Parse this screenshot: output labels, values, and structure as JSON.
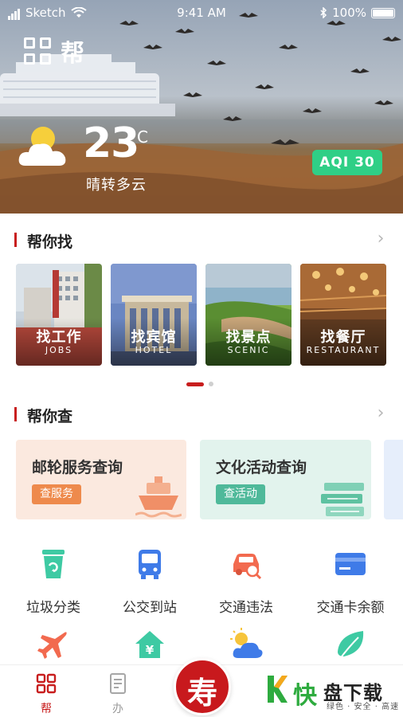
{
  "status_bar": {
    "carrier": "Sketch",
    "time": "9:41 AM",
    "battery": "100%"
  },
  "header": {
    "title": "帮"
  },
  "weather": {
    "temperature": "23",
    "unit": "°C",
    "condition": "晴转多云",
    "aqi_label": "AQI 30",
    "icon": "sun-cloud-icon"
  },
  "section_find": {
    "title": "帮你找",
    "cards": [
      {
        "label": "找工作",
        "sublabel": "JOBS"
      },
      {
        "label": "找宾馆",
        "sublabel": "HOTEL"
      },
      {
        "label": "找景点",
        "sublabel": "SCENIC"
      },
      {
        "label": "找餐厅",
        "sublabel": "RESTAURANT"
      }
    ]
  },
  "section_check": {
    "title": "帮你查",
    "cards": [
      {
        "title": "邮轮服务查询",
        "button": "查服务"
      },
      {
        "title": "文化活动查询",
        "button": "查活动"
      }
    ]
  },
  "services": [
    {
      "label": "垃圾分类",
      "icon": "trash-bin-icon"
    },
    {
      "label": "公交到站",
      "icon": "bus-icon"
    },
    {
      "label": "交通违法",
      "icon": "car-search-icon"
    },
    {
      "label": "交通卡余额",
      "icon": "card-icon"
    },
    {
      "label": "",
      "icon": "airplane-icon"
    },
    {
      "label": "",
      "icon": "house-yuan-icon"
    },
    {
      "label": "",
      "icon": "weather-icon"
    },
    {
      "label": "",
      "icon": "leaf-icon"
    }
  ],
  "tabbar": {
    "tabs": [
      {
        "label": "帮",
        "icon": "grid-icon"
      },
      {
        "label": "办",
        "icon": "document-icon"
      }
    ],
    "center_glyph": "寿"
  },
  "watermark": {
    "char": "快",
    "text": "盘下载",
    "slogan": "绿色 · 安全 · 高速"
  },
  "colors": {
    "accent": "#c81e1e",
    "aqi": "#2fcf86",
    "cruise_card": "#fbe9e0",
    "culture_card": "#e3f3ee"
  }
}
